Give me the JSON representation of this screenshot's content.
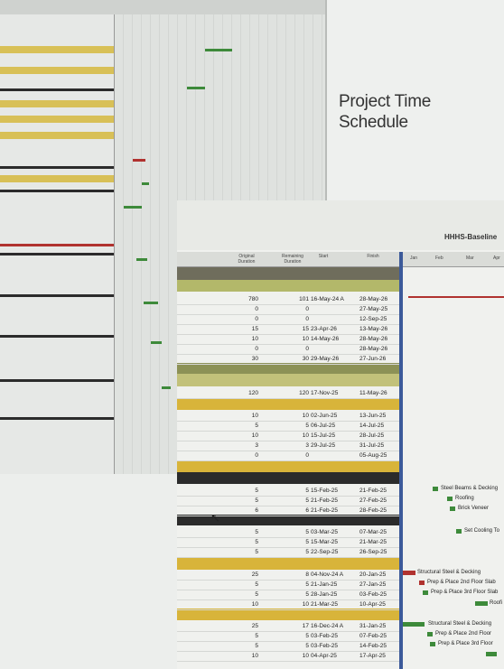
{
  "title": "Project Time Schedule",
  "baseline_title": "HHHS-Baseline",
  "columns": {
    "original_duration": "Original Duration",
    "remaining_duration": "Remaining Duration",
    "start": "Start",
    "finish": "Finish"
  },
  "months": [
    "Jan",
    "Feb",
    "Mar",
    "Apr"
  ],
  "rows": [
    {
      "od": "780",
      "rd": "101",
      "start": "16-May-24 A",
      "finish": "28-May-26"
    },
    {
      "od": "0",
      "rd": "0",
      "start": "",
      "finish": "27-May-25"
    },
    {
      "od": "0",
      "rd": "0",
      "start": "",
      "finish": "12-Sep-25"
    },
    {
      "od": "15",
      "rd": "15",
      "start": "23-Apr-26",
      "finish": "13-May-26"
    },
    {
      "od": "10",
      "rd": "10",
      "start": "14-May-26",
      "finish": "28-May-26"
    },
    {
      "od": "0",
      "rd": "0",
      "start": "",
      "finish": "28-May-26"
    },
    {
      "od": "30",
      "rd": "30",
      "start": "29-May-26",
      "finish": "27-Jun-26"
    },
    {
      "od": "120",
      "rd": "120",
      "start": "17-Nov-25",
      "finish": "11-May-26"
    },
    {
      "od": "10",
      "rd": "10",
      "start": "02-Jun-25",
      "finish": "13-Jun-25"
    },
    {
      "od": "5",
      "rd": "5",
      "start": "06-Jul-25",
      "finish": "14-Jul-25"
    },
    {
      "od": "10",
      "rd": "10",
      "start": "15-Jul-25",
      "finish": "28-Jul-25"
    },
    {
      "od": "3",
      "rd": "3",
      "start": "29-Jul-25",
      "finish": "31-Jul-25"
    },
    {
      "od": "0",
      "rd": "0",
      "start": "",
      "finish": "05-Aug-25"
    },
    {
      "od": "5",
      "rd": "5",
      "start": "15-Feb-25",
      "finish": "21-Feb-25"
    },
    {
      "od": "5",
      "rd": "5",
      "start": "21-Feb-25",
      "finish": "27-Feb-25"
    },
    {
      "od": "6",
      "rd": "6",
      "start": "21-Feb-25",
      "finish": "28-Feb-25"
    },
    {
      "od": "5",
      "rd": "5",
      "start": "03-Mar-25",
      "finish": "07-Mar-25"
    },
    {
      "od": "5",
      "rd": "5",
      "start": "15-Mar-25",
      "finish": "21-Mar-25"
    },
    {
      "od": "5",
      "rd": "5",
      "start": "22-Sep-25",
      "finish": "26-Sep-25"
    },
    {
      "od": "25",
      "rd": "8",
      "start": "04-Nov-24 A",
      "finish": "20-Jan-25"
    },
    {
      "od": "5",
      "rd": "5",
      "start": "21-Jan-25",
      "finish": "27-Jan-25"
    },
    {
      "od": "5",
      "rd": "5",
      "start": "28-Jan-25",
      "finish": "03-Feb-25"
    },
    {
      "od": "10",
      "rd": "10",
      "start": "21-Mar-25",
      "finish": "10-Apr-25"
    },
    {
      "od": "25",
      "rd": "17",
      "start": "16-Dec-24 A",
      "finish": "31-Jan-25"
    },
    {
      "od": "5",
      "rd": "5",
      "start": "03-Feb-25",
      "finish": "07-Feb-25"
    },
    {
      "od": "5",
      "rd": "5",
      "start": "03-Feb-25",
      "finish": "14-Feb-25"
    },
    {
      "od": "10",
      "rd": "10",
      "start": "04-Apr-25",
      "finish": "17-Apr-25"
    }
  ],
  "gantt_labels": {
    "steel_beams": "Steel Beams & Decking",
    "roofing": "Roofing",
    "brick_veneer": "Brick Veneer",
    "set_cooling": "Set Cooling To",
    "structural_steel_1": "Structural Steel & Decking",
    "prep_2nd_1": "Prep & Place 2nd Floor Slab",
    "prep_3rd_1": "Prep & Place 3rd Floor Slab",
    "roof_1": "Roofi",
    "structural_steel_2": "Structural Steel & Decking",
    "prep_2nd_2": "Prep & Place 2nd Floor",
    "prep_3rd_2": "Prep & Place 3rd Floor"
  },
  "colors": {
    "yellow": "#d8b43a",
    "olive": "#b3b86a",
    "dark": "#2b2b2b",
    "bar_green": "#3d8a3a",
    "bar_red": "#b0322f",
    "bar_blue": "#3c5a9a"
  }
}
